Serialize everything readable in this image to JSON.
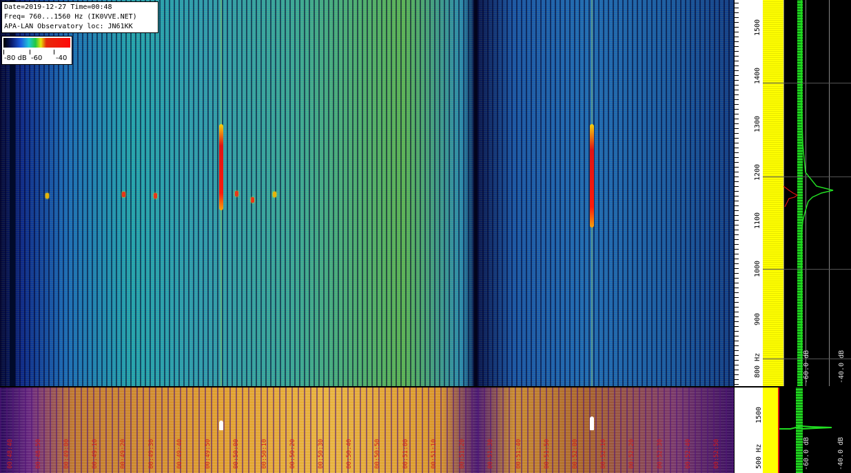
{
  "info": {
    "line1": "Date=2019-12-27 Time=00:48",
    "line2": "Freq= 760...1560 Hz (IK0VVE.NET)",
    "line3": "APA-LAN Observatory loc: JN61KK"
  },
  "legend": {
    "labels": [
      "-80 dB",
      "-60",
      "-40"
    ]
  },
  "freq_scale": {
    "ticks": [
      "1500",
      "1400",
      "1300",
      "1200",
      "1100",
      "1000",
      "900",
      "800 Hz"
    ]
  },
  "spectrum_scale": {
    "labels": [
      "-60.0 dB",
      "-40.0 dB"
    ]
  },
  "bottom_scale": {
    "ticks": [
      "1500",
      "500 Hz"
    ]
  },
  "bottom_spectrum_scale": {
    "labels": [
      "-60.0 dB",
      "-40.0 dB"
    ]
  },
  "time_labels": [
    "00:48:40",
    "00:48:50",
    "00:49:00",
    "00:49:10",
    "00:49:20",
    "00:49:30",
    "00:49:40",
    "00:49:50",
    "00:50:00",
    "00:50:10",
    "00:50:20",
    "00:50:30",
    "00:50:40",
    "00:50:50",
    "00:51:00",
    "00:51:10",
    "00:51:20",
    "00:51:30",
    "00:51:40",
    "00:51:50",
    "00:52:00",
    "00:52:10",
    "00:52:20",
    "00:52:30",
    "00:52:40",
    "00:52:50"
  ],
  "colors": {
    "echo": "#e01414",
    "spectrum_avg": "#ffff00",
    "spectrum_peak": "#22dd22"
  }
}
